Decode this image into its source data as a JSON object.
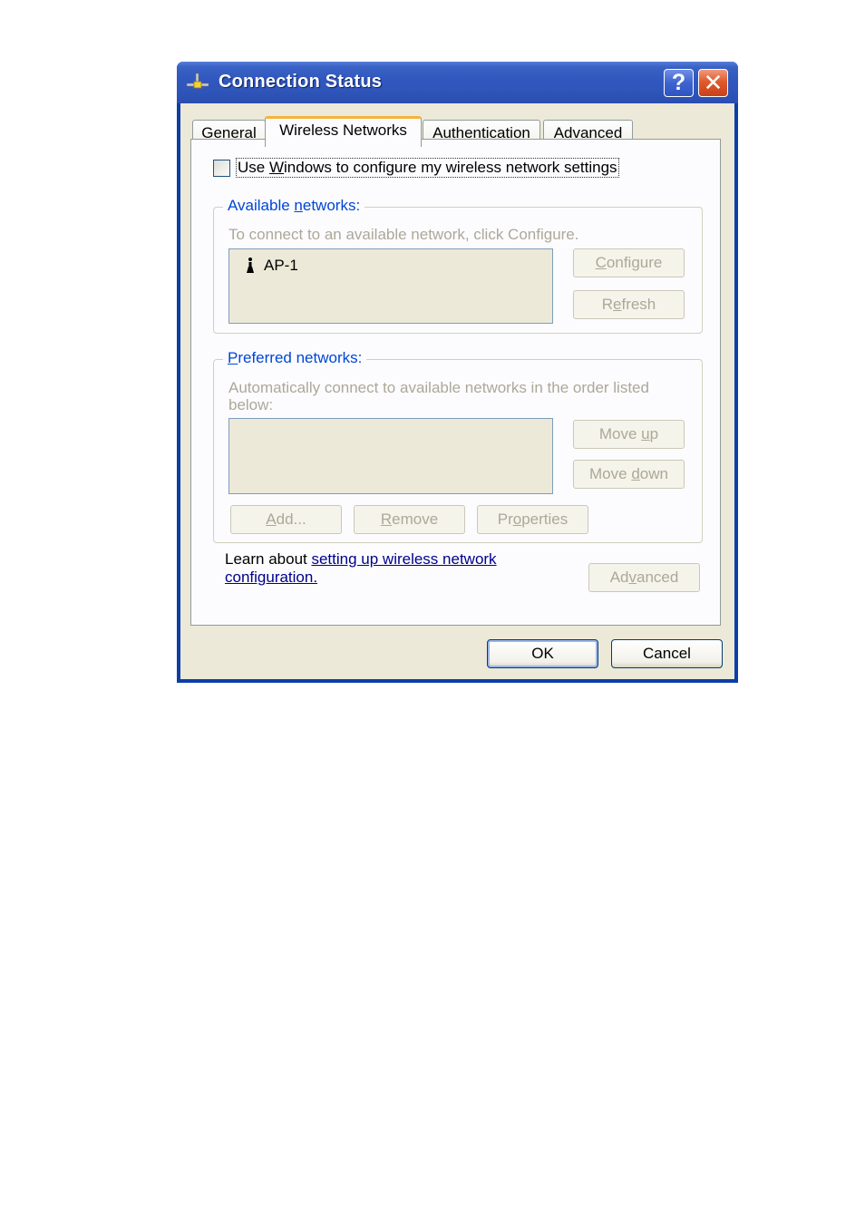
{
  "window": {
    "title": "Connection Status",
    "icons": {
      "app": "network-connection-icon",
      "help": "help-icon",
      "close": "close-icon"
    },
    "help_glyph": "?",
    "close_glyph": "✕"
  },
  "tabs": [
    {
      "label": "General",
      "active": false
    },
    {
      "label": "Wireless Networks",
      "active": true
    },
    {
      "label": "Authentication",
      "active": false
    },
    {
      "label": "Advanced",
      "active": false
    }
  ],
  "wireless": {
    "use_windows_checkbox": {
      "checked": false,
      "label_pre": "Use ",
      "label_accel": "W",
      "label_post": "indows to configure my wireless network settings"
    },
    "available": {
      "legend_pre": "Available ",
      "legend_accel": "n",
      "legend_post": "etworks:",
      "hint": "To connect to an available network, click Configure.",
      "networks": [
        {
          "name": "AP-1",
          "icon": "wireless-ap-icon"
        }
      ],
      "configure": {
        "pre": "",
        "accel": "C",
        "post": "onfigure",
        "enabled": false
      },
      "refresh": {
        "pre": "R",
        "accel": "e",
        "post": "fresh",
        "enabled": false
      }
    },
    "preferred": {
      "legend_pre": "",
      "legend_accel": "P",
      "legend_post": "referred networks:",
      "hint": "Automatically connect to available networks in the order listed below:",
      "networks": [],
      "move_up": {
        "pre": "Move ",
        "accel": "u",
        "post": "p",
        "enabled": false
      },
      "move_down": {
        "pre": "Move ",
        "accel": "d",
        "post": "own",
        "enabled": false
      },
      "add": {
        "pre": "",
        "accel": "A",
        "post": "dd...",
        "enabled": false
      },
      "remove": {
        "pre": "",
        "accel": "R",
        "post": "emove",
        "enabled": false
      },
      "properties": {
        "pre": "Pr",
        "accel": "o",
        "post": "perties",
        "enabled": false
      }
    },
    "learn_text": "Learn about ",
    "learn_link": "setting up wireless network configuration.",
    "advanced": {
      "pre": "Ad",
      "accel": "v",
      "post": "anced",
      "enabled": false
    }
  },
  "footer": {
    "ok": "OK",
    "cancel": "Cancel"
  }
}
